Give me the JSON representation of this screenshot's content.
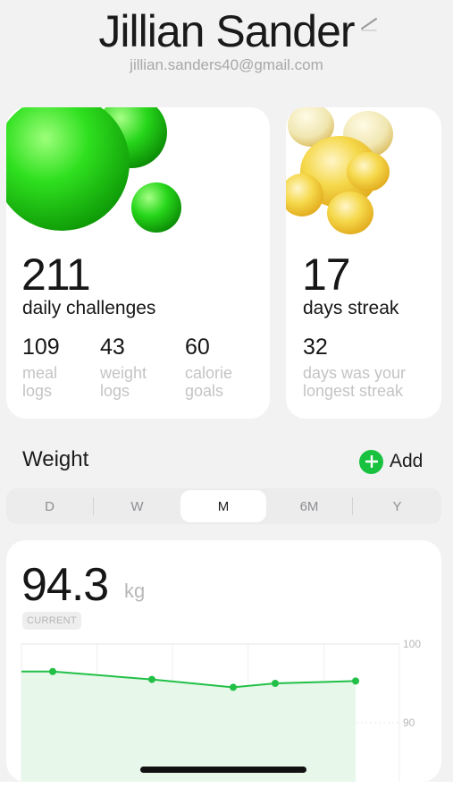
{
  "profile": {
    "name": "Jillian Sander",
    "email": "jillian.sanders40@gmail.com",
    "edit_icon": "pencil-icon"
  },
  "stats": {
    "challenges": {
      "value": "211",
      "label": "daily challenges",
      "details": [
        {
          "value": "109",
          "label_line1": "meal",
          "label_line2": "logs"
        },
        {
          "value": "43",
          "label_line1": "weight",
          "label_line2": "logs"
        },
        {
          "value": "60",
          "label_line1": "calorie",
          "label_line2": "goals"
        }
      ]
    },
    "streak": {
      "value": "17",
      "label": "days streak",
      "detail_value": "32",
      "detail_label_line1": "days was your",
      "detail_label_line2": "longest streak"
    }
  },
  "weight_section": {
    "title": "Weight",
    "add_label": "Add",
    "add_icon": "plus-icon",
    "periods": [
      "D",
      "W",
      "M",
      "6M",
      "Y"
    ],
    "active_period": "M",
    "current_value": "94.3",
    "unit": "kg",
    "badge": "CURRENT"
  },
  "chart_data": {
    "type": "line",
    "ylim": [
      86,
      100
    ],
    "y_ticks": [
      "100",
      "90"
    ],
    "series": [
      {
        "values": [
          96.5,
          95.5,
          94.5,
          95.0,
          95.3
        ]
      }
    ],
    "line_color": "#22c047",
    "fill_color": "#e7f7ea",
    "grid": true
  },
  "colors": {
    "accent": "#18c23f",
    "background": "#f2f2f2",
    "card": "#ffffff"
  }
}
